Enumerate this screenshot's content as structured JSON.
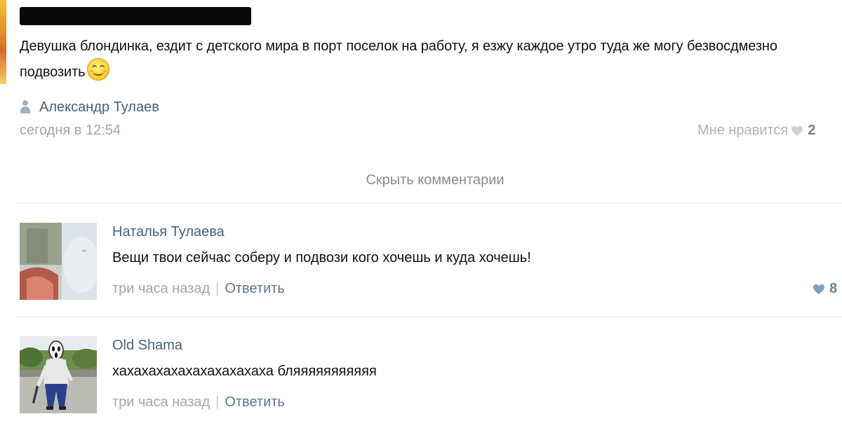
{
  "post": {
    "author_redacted_text": "",
    "text": "Девушка блондинка, ездит с детского мира в порт поселок на работу, я езжу каждое утро туда же могу безвосдмезно подвозить",
    "author": "Александр Тулаев",
    "date": "сегодня в 12:54",
    "like_label": "Мне нравится",
    "like_count": "2"
  },
  "hide_comments_label": "Скрыть комментарии",
  "comments": [
    {
      "author": "Наталья Тулаева",
      "text": "Вещи твои сейчас соберу и подвози кого хочешь и куда хочешь!",
      "time": "три часа назад",
      "separator": "|",
      "reply_label": "Ответить",
      "like_count": "8"
    },
    {
      "author": "Old Shama",
      "text": "хахахахахахахахахахаха бляяяяяяяяяяя",
      "time": "три часа назад",
      "separator": "|",
      "reply_label": "Ответить"
    }
  ],
  "colors": {
    "link": "#4a5f7c",
    "muted": "#a6a6a6",
    "like_heart": "#8aa6c4"
  },
  "icons": [
    "person-icon",
    "heart-icon",
    "smile-emoji-icon"
  ]
}
